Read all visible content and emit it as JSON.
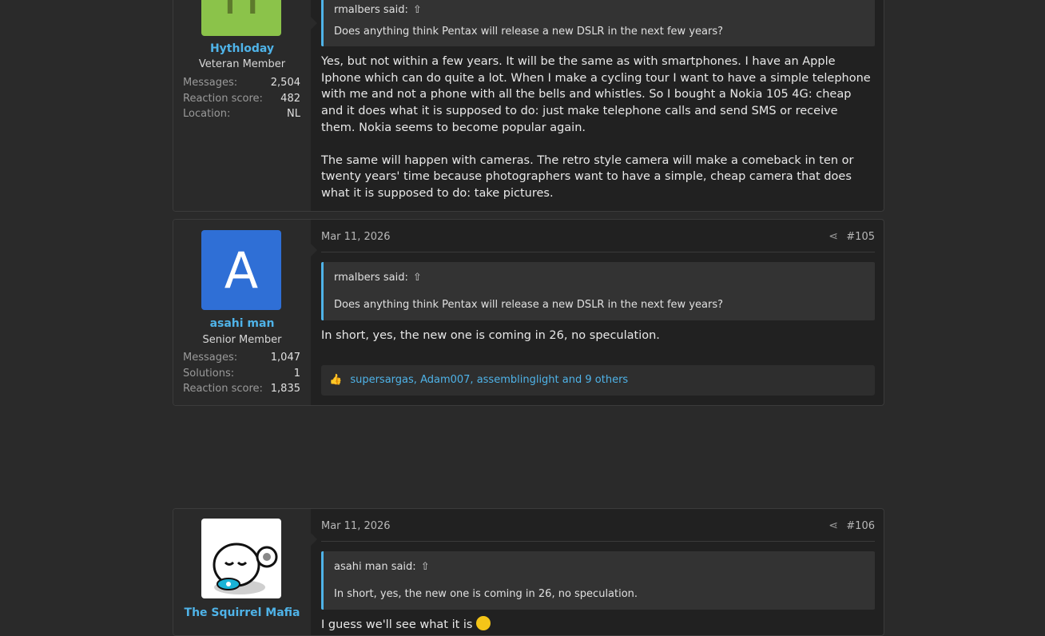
{
  "posts": [
    {
      "avatar_letter": "H",
      "avatar_color": "#8bc34a",
      "username": "Hythloday",
      "user_title": "Veteran Member",
      "stats": [
        {
          "label": "Messages:",
          "value": "2,504"
        },
        {
          "label": "Reaction score:",
          "value": "482"
        },
        {
          "label": "Location:",
          "value": "NL"
        }
      ],
      "quote_author": "rmalbers said:",
      "quote_text": "Does anything think Pentax will release a new DSLR in the next few years?",
      "paragraphs": [
        "Yes, but not within a few years. It will be the same as with smartphones. I have an Apple Iphone which can do quite a lot. When I make a cycling tour I want to have a simple telephone with me and not a phone with all the bells and whistles. So I bought a Nokia 105 4G: cheap and it does what it is supposed to do: just make telephone calls and send SMS or receive them. Nokia seems to become popular again.",
        "The same will happen with cameras. The retro style camera will make a comeback in ten or twenty years' time because photographers want to have a simple, cheap camera that does what it is supposed to do: take pictures."
      ]
    },
    {
      "avatar_letter": "A",
      "avatar_color": "#2f6fd6",
      "username": "asahi man",
      "user_title": "Senior Member",
      "stats": [
        {
          "label": "Messages:",
          "value": "1,047"
        },
        {
          "label": "Solutions:",
          "value": "1"
        },
        {
          "label": "Reaction score:",
          "value": "1,835"
        }
      ],
      "date": "Mar 11, 2026",
      "post_number": "#105",
      "quote_author": "rmalbers said:",
      "quote_text": "Does anything think Pentax will release a new DSLR in the next few years?",
      "paragraphs": [
        "In short, yes, the new one is coming in 26, no speculation."
      ],
      "reactions": {
        "users": [
          "supersargas",
          "Adam007",
          "assemblinglight"
        ],
        "others": "9 others",
        "and": "and"
      }
    },
    {
      "username": "The Squirrel Mafia",
      "date": "Mar 11, 2026",
      "post_number": "#106",
      "quote_author": "asahi man said:",
      "quote_text": "In short, yes, the new one is coming in 26, no speculation.",
      "partial_text": "I guess we'll see what it is"
    }
  ]
}
